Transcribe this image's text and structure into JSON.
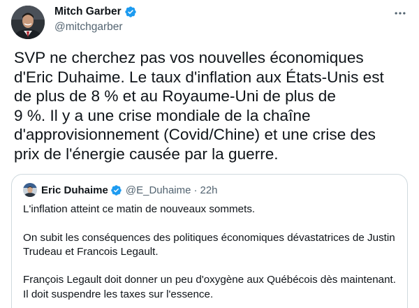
{
  "author": {
    "name": "Mitch Garber",
    "handle": "@mitchgarber"
  },
  "tweet": {
    "text": "SVP ne cherchez pas vos nouvelles économiques\nd'Eric Duhaime. Le taux d'inflation aux États-Unis est\nde plus de 8 % et au Royaume-Uni de plus de\n9 %. Il y a une crise mondiale de la chaîne\nd'approvisionnement (Covid/Chine) et une crise des\nprix de l'énergie causée par la guerre."
  },
  "quoted": {
    "name": "Eric Duhaime",
    "handle": "@E_Duhaime",
    "separator": "·",
    "time": "22h",
    "paragraphs": [
      "L'inflation atteint ce matin de nouveaux sommets.",
      "On subit les conséquences des politiques économiques dévastatrices de Justin\nTrudeau et Francois Legault.",
      "François Legault doit donner un peu d'oxygène aux Québécois dès maintenant.\nIl doit suspendre les taxes sur l'essence."
    ]
  },
  "icons": {
    "verified": "verified-badge-icon",
    "more": "more-horizontal-icon"
  },
  "colors": {
    "verified_blue": "#1d9bf0",
    "secondary_text": "#536471",
    "border": "#cfd9de"
  }
}
